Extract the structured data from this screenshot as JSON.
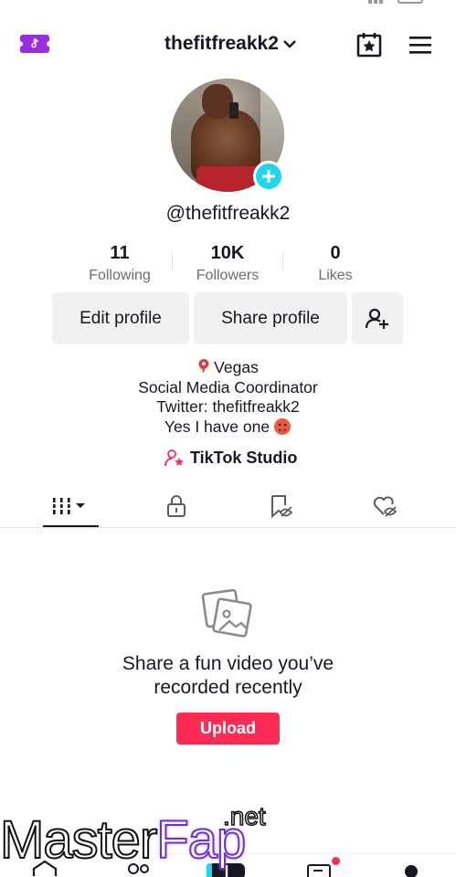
{
  "header": {
    "username": "thefitfreakk2",
    "icons": [
      "promo-ticket-icon",
      "chevron-down-icon",
      "calendar-star-icon",
      "hamburger-menu-icon"
    ],
    "promo_color": "#9b2de0"
  },
  "profile": {
    "handle": "@thefitfreakk2",
    "add_badge_color": "#20d5ec"
  },
  "stats": [
    {
      "value": "11",
      "label": "Following"
    },
    {
      "value": "10K",
      "label": "Followers"
    },
    {
      "value": "0",
      "label": "Likes"
    }
  ],
  "actions": {
    "edit": "Edit profile",
    "share": "Share profile",
    "add_friend_icon": "add-friend-icon"
  },
  "bio": {
    "location": "Vegas",
    "line2": "Social Media Coordinator",
    "line3": "Twitter: thefitfreakk2",
    "line4": "Yes I have one"
  },
  "studio": {
    "label": "TikTok Studio",
    "icon_color": "#fe2c55"
  },
  "tabs": [
    {
      "name": "videos-grid",
      "icon": "grid-bars-icon",
      "active": true
    },
    {
      "name": "private",
      "icon": "lock-icon",
      "active": false
    },
    {
      "name": "saved",
      "icon": "bookmark-hidden-icon",
      "active": false
    },
    {
      "name": "liked",
      "icon": "heart-hidden-icon",
      "active": false
    }
  ],
  "empty_state": {
    "title_line1": "Share a fun video you’ve",
    "title_line2": "recorded recently",
    "upload_label": "Upload",
    "upload_color": "#fe2c55"
  },
  "bottom_nav": {
    "items": [
      "home-icon",
      "friends-icon",
      "create-icon",
      "inbox-icon",
      "profile-icon"
    ],
    "inbox_badge_color": "#fe2c55"
  },
  "watermark": {
    "suffix": ".net",
    "word1": "Master",
    "word2": "Fap"
  }
}
